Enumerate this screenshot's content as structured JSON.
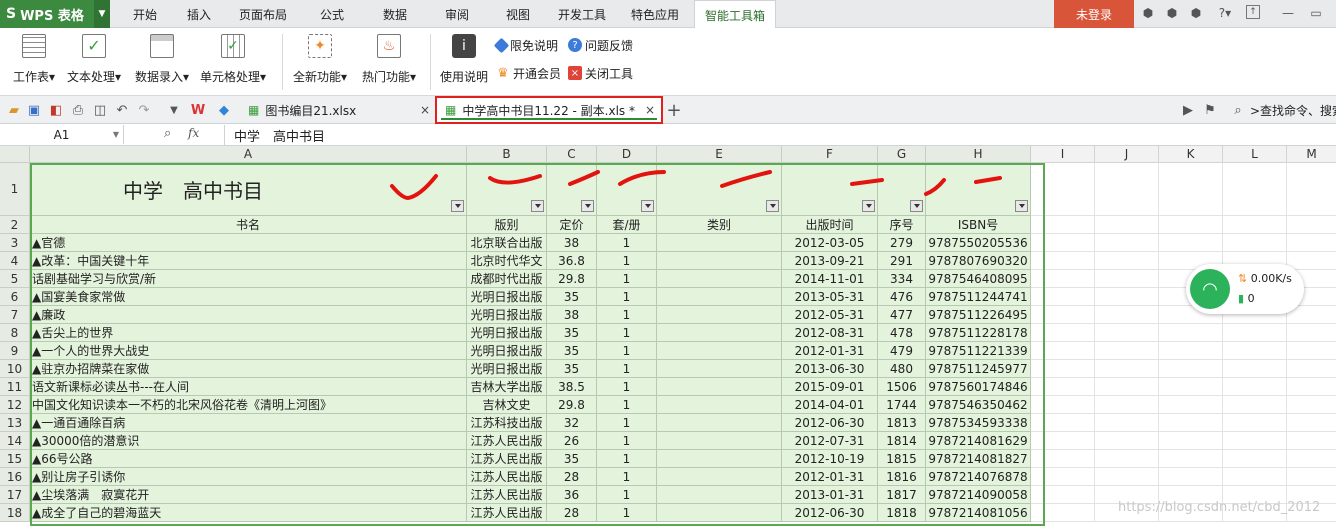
{
  "app": {
    "logo_label": "WPS 表格",
    "login_label": "未登录",
    "help_label": "?"
  },
  "menu": {
    "tabs": [
      "开始",
      "插入",
      "页面布局",
      "公式",
      "数据",
      "审阅",
      "视图",
      "开发工具",
      "特色应用",
      "智能工具箱"
    ],
    "active": "智能工具箱"
  },
  "ribbon": {
    "buttons": [
      "工作表",
      "文本处理",
      "数据录入",
      "单元格处理",
      "全新功能",
      "热门功能",
      "使用说明"
    ],
    "small": [
      "限免说明",
      "问题反馈",
      "开通会员",
      "关闭工具"
    ]
  },
  "tabs": {
    "doc1": "图书编目21.xlsx",
    "doc2": "中学高中书目11.22 - 副本.xls *",
    "search_placeholder": ">查找命令、搜索"
  },
  "formula": {
    "cell_ref": "A1",
    "fx": "fx",
    "content": "中学　高中书目"
  },
  "sheet": {
    "columns": [
      "A",
      "B",
      "C",
      "D",
      "E",
      "F",
      "G",
      "H",
      "I",
      "J",
      "K",
      "L",
      "M"
    ],
    "title": "中学　高中书目",
    "headers": [
      "书名",
      "版别",
      "定价",
      "套/册",
      "类别",
      "出版时间",
      "序号",
      "ISBN号"
    ],
    "rows": [
      [
        "▲官德",
        "北京联合出版",
        "38",
        "1",
        "",
        "2012-03-05",
        "279",
        "9787550205536"
      ],
      [
        "▲改革：中国关键十年",
        "北京时代华文",
        "36.8",
        "1",
        "",
        "2013-09-21",
        "291",
        "9787807690320"
      ],
      [
        "话剧基础学习与欣赏/新",
        "成都时代出版",
        "29.8",
        "1",
        "",
        "2014-11-01",
        "334",
        "9787546408095"
      ],
      [
        "▲国宴美食家常做",
        "光明日报出版",
        "35",
        "1",
        "",
        "2013-05-31",
        "476",
        "9787511244741"
      ],
      [
        "▲廉政",
        "光明日报出版",
        "38",
        "1",
        "",
        "2012-05-31",
        "477",
        "9787511226495"
      ],
      [
        "▲舌尖上的世界",
        "光明日报出版",
        "35",
        "1",
        "",
        "2012-08-31",
        "478",
        "9787511228178"
      ],
      [
        "▲一个人的世界大战史",
        "光明日报出版",
        "35",
        "1",
        "",
        "2012-01-31",
        "479",
        "9787511221339"
      ],
      [
        "▲驻京办招牌菜在家做",
        "光明日报出版",
        "35",
        "1",
        "",
        "2013-06-30",
        "480",
        "9787511245977"
      ],
      [
        "语文新课标必读丛书---在人间",
        "吉林大学出版",
        "38.5",
        "1",
        "",
        "2015-09-01",
        "1506",
        "9787560174846"
      ],
      [
        "中国文化知识读本一不朽的北宋风俗花卷《清明上河图》",
        "吉林文史",
        "29.8",
        "1",
        "",
        "2014-04-01",
        "1744",
        "9787546350462"
      ],
      [
        "▲一通百通除百病",
        "江苏科技出版",
        "32",
        "1",
        "",
        "2012-06-30",
        "1813",
        "9787534593338"
      ],
      [
        "▲30000倍的潜意识",
        "江苏人民出版",
        "26",
        "1",
        "",
        "2012-07-31",
        "1814",
        "9787214081629"
      ],
      [
        "▲66号公路",
        "江苏人民出版",
        "35",
        "1",
        "",
        "2012-10-19",
        "1815",
        "9787214081827"
      ],
      [
        "▲别让房子引诱你",
        "江苏人民出版",
        "28",
        "1",
        "",
        "2012-01-31",
        "1816",
        "9787214076878"
      ],
      [
        "▲尘埃落满　寂寞花开",
        "江苏人民出版",
        "36",
        "1",
        "",
        "2013-01-31",
        "1817",
        "9787214090058"
      ],
      [
        "▲成全了自己的碧海蓝天",
        "江苏人民出版",
        "28",
        "1",
        "",
        "2012-06-30",
        "1818",
        "9787214081056"
      ]
    ]
  },
  "widget": {
    "speed": "0.00K/s",
    "count": "0"
  },
  "watermark": "https://blog.csdn.net/cbd_2012"
}
